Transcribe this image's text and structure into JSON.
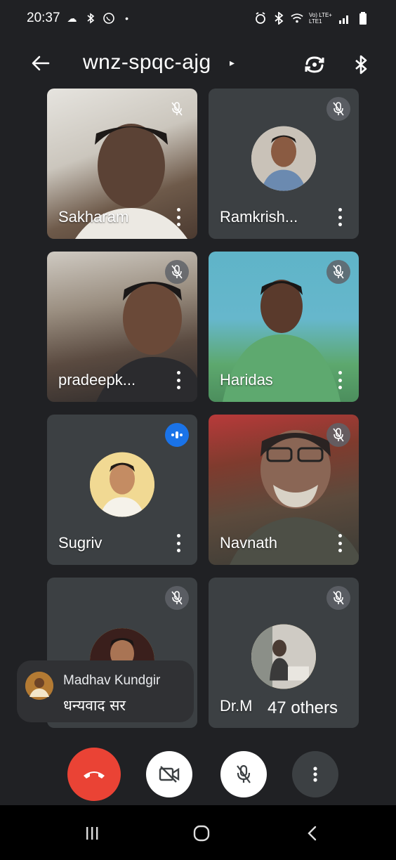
{
  "status_bar": {
    "time": "20:37",
    "left_icons": [
      "cloud-icon",
      "bluetooth-icon",
      "whatsapp-icon",
      "dot-icon"
    ],
    "right_icons": [
      "alarm-icon",
      "bluetooth-icon",
      "wifi-icon",
      "signal-icon",
      "battery-icon"
    ],
    "network_label": "Vo) LTE+ LTE1"
  },
  "top_bar": {
    "meeting_code": "wnz-spqc-ajg",
    "icons": [
      "back-arrow-icon",
      "switch-camera-icon",
      "bluetooth-audio-icon"
    ]
  },
  "participants": [
    {
      "name": "Sakharam",
      "muted": true,
      "video": true
    },
    {
      "name": "Ramkrish...",
      "muted": true,
      "video": false
    },
    {
      "name": "pradeepk...",
      "muted": true,
      "video": true
    },
    {
      "name": "Haridas",
      "muted": true,
      "video": true
    },
    {
      "name": "Sugriv",
      "muted": false,
      "speaking": true,
      "video": false
    },
    {
      "name": "Navnath",
      "muted": true,
      "video": true
    },
    {
      "name": "",
      "muted": true,
      "video": false
    },
    {
      "name": "Dr.M",
      "muted": true,
      "video": false
    }
  ],
  "chat_notification": {
    "sender": "Madhav Kundgir",
    "message": "धन्यवाद सर"
  },
  "others_badge": "47 others",
  "controls": {
    "icons": [
      "end-call-icon",
      "camera-off-icon",
      "mic-off-icon",
      "more-options-icon"
    ],
    "end_color": "#ea4335"
  },
  "nav_bar": {
    "icons": [
      "recents-icon",
      "home-icon",
      "back-icon"
    ]
  }
}
